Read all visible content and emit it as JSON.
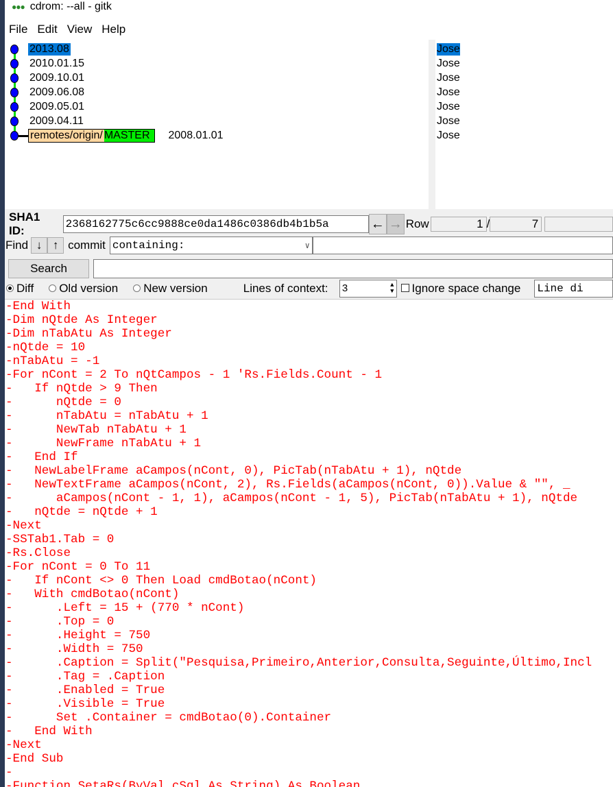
{
  "window": {
    "title": "cdrom: --all - gitk"
  },
  "menu": [
    "File",
    "Edit",
    "View",
    "Help"
  ],
  "commits": [
    {
      "subject": "2013.08",
      "author": "Jose",
      "selected": true
    },
    {
      "subject": "2010.01.15",
      "author": "Jose"
    },
    {
      "subject": "2009.10.01",
      "author": "Jose"
    },
    {
      "subject": "2009.06.08",
      "author": "Jose"
    },
    {
      "subject": "2009.05.01",
      "author": "Jose"
    },
    {
      "subject": "2009.04.11",
      "author": "Jose"
    },
    {
      "subject": "2008.01.01",
      "author": "Jose",
      "ref_remote": "remotes/origin/",
      "ref_branch": "MASTER"
    }
  ],
  "sha": {
    "label": "SHA1 ID:",
    "value": "2368162775c6cc9888ce0da1486c0386db4b1b5a",
    "row_label": "Row",
    "row": "1",
    "sep": "/",
    "total": "7"
  },
  "find": {
    "label": "Find",
    "commit_label": "commit",
    "mode": "containing:",
    "search_button": "Search"
  },
  "diffopts": {
    "diff": "Diff",
    "old": "Old version",
    "new": "New version",
    "context_label": "Lines of context:",
    "context": "3",
    "ignore": "Ignore space change",
    "linediff": "Line di"
  },
  "colors": {
    "removed": "#ff0000",
    "selection": "#0078d7",
    "graph_line": "#00dd00",
    "node": "#0000ff"
  },
  "diff_lines": [
    "-End With",
    "-Dim nQtde As Integer",
    "-Dim nTabAtu As Integer",
    "-nQtde = 10",
    "-nTabAtu = -1",
    "-For nCont = 2 To nQtCampos - 1 'Rs.Fields.Count - 1",
    "-   If nQtde > 9 Then",
    "-      nQtde = 0",
    "-      nTabAtu = nTabAtu + 1",
    "-      NewTab nTabAtu + 1",
    "-      NewFrame nTabAtu + 1",
    "-   End If",
    "-   NewLabelFrame aCampos(nCont, 0), PicTab(nTabAtu + 1), nQtde",
    "-   NewTextFrame aCampos(nCont, 2), Rs.Fields(aCampos(nCont, 0)).Value & \"\", _",
    "-      aCampos(nCont - 1, 1), aCampos(nCont - 1, 5), PicTab(nTabAtu + 1), nQtde",
    "-   nQtde = nQtde + 1",
    "-Next",
    "-SSTab1.Tab = 0",
    "-Rs.Close",
    "-For nCont = 0 To 11",
    "-   If nCont <> 0 Then Load cmdBotao(nCont)",
    "-   With cmdBotao(nCont)",
    "-      .Left = 15 + (770 * nCont)",
    "-      .Top = 0",
    "-      .Height = 750",
    "-      .Width = 750",
    "-      .Caption = Split(\"Pesquisa,Primeiro,Anterior,Consulta,Seguinte,Último,Incl",
    "-      .Tag = .Caption",
    "-      .Enabled = True",
    "-      .Visible = True",
    "-      Set .Container = cmdBotao(0).Container",
    "-   End With",
    "-Next",
    "-End Sub",
    "-",
    "-Function SetaRs(ByVal cSql As String) As Boolean"
  ]
}
